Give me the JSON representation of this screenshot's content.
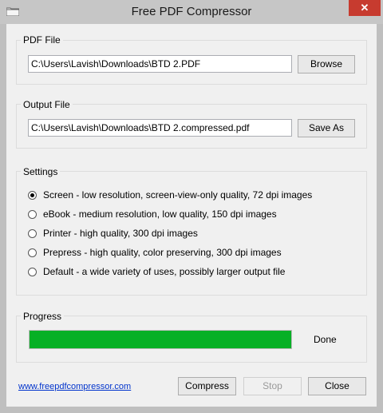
{
  "window": {
    "title": "Free PDF Compressor",
    "close_glyph": "✕"
  },
  "pdf_file": {
    "label": "PDF File",
    "value": "C:\\Users\\Lavish\\Downloads\\BTD  2.PDF",
    "browse_label": "Browse"
  },
  "output_file": {
    "label": "Output File",
    "value": "C:\\Users\\Lavish\\Downloads\\BTD  2.compressed.pdf",
    "save_as_label": "Save As"
  },
  "settings": {
    "label": "Settings",
    "options": [
      {
        "label": "Screen - low resolution, screen-view-only quality, 72 dpi images",
        "checked": true
      },
      {
        "label": "eBook - medium resolution, low quality, 150 dpi images",
        "checked": false
      },
      {
        "label": "Printer - high quality, 300 dpi images",
        "checked": false
      },
      {
        "label": "Prepress - high quality, color preserving, 300 dpi images",
        "checked": false
      },
      {
        "label": "Default - a wide variety of uses, possibly larger output file",
        "checked": false
      }
    ]
  },
  "progress": {
    "label": "Progress",
    "fraction": 1.0,
    "status": "Done",
    "color": "#06b025"
  },
  "footer": {
    "link": "www.freepdfcompressor.com",
    "compress_label": "Compress",
    "stop_label": "Stop",
    "close_label": "Close"
  }
}
